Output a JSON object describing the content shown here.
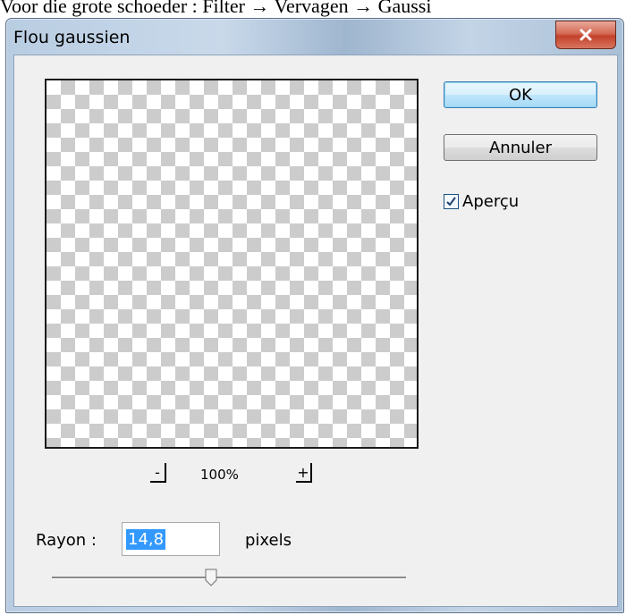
{
  "caption": "Voor die grote schoeder : Filter → Vervagen → Gaussi",
  "window": {
    "title": "Flou gaussien",
    "close_icon": "close-icon"
  },
  "buttons": {
    "ok_label": "OK",
    "cancel_label": "Annuler"
  },
  "preview_option": {
    "label": "Aperçu",
    "checked": true
  },
  "zoom": {
    "minus_label": "-",
    "plus_label": "+",
    "level": "100%"
  },
  "radius": {
    "label": "Rayon :",
    "value": "14,8",
    "unit": "pixels",
    "slider_level": 0.45
  },
  "colors": {
    "close_button": "#c2412b",
    "selection": "#3399ff"
  }
}
